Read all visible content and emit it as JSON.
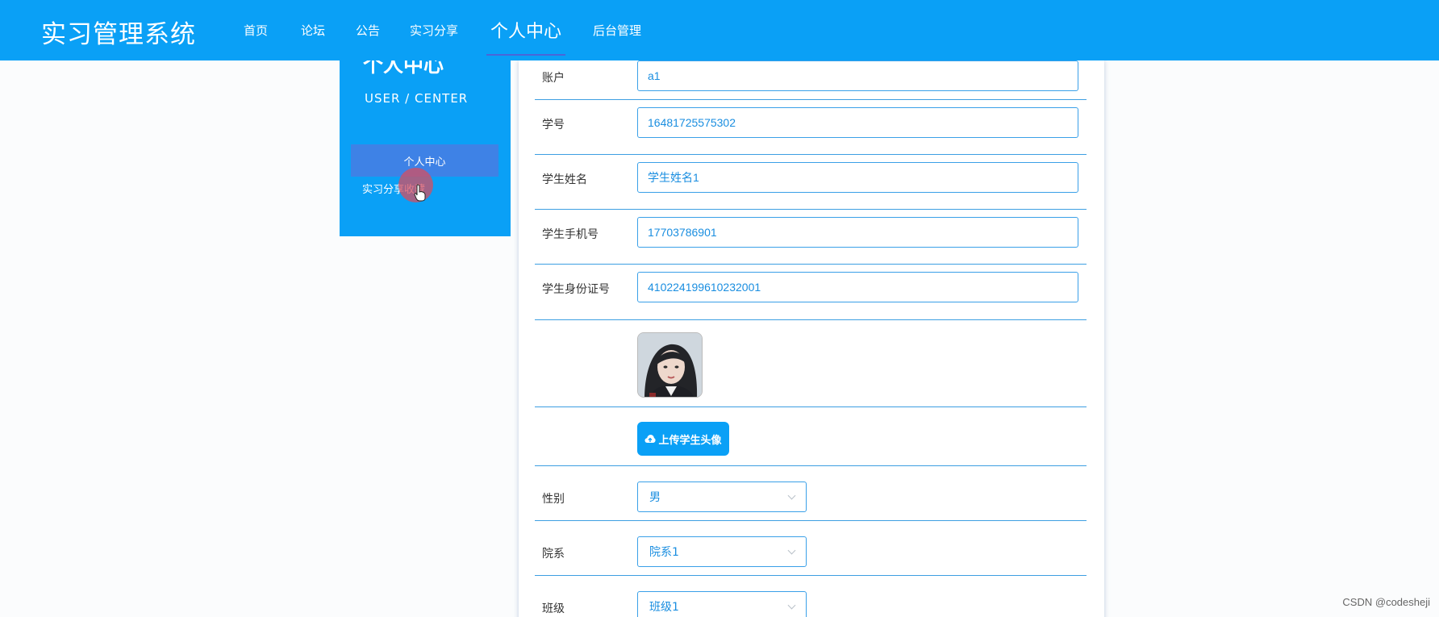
{
  "header": {
    "app_title": "实习管理系统",
    "nav": [
      "首页",
      "论坛",
      "公告",
      "实习分享",
      "个人中心",
      "后台管理"
    ],
    "active_nav": "个人中心"
  },
  "sidebar": {
    "title": "个人中心",
    "subtitle": "USER / CENTER",
    "items": [
      {
        "label": "个人中心",
        "active": true
      },
      {
        "label": "实习分享收藏",
        "active": false
      }
    ]
  },
  "form": {
    "account": {
      "label": "账户",
      "value": "a1"
    },
    "student_no": {
      "label": "学号",
      "value": "16481725575302"
    },
    "student_name": {
      "label": "学生姓名",
      "value": "学生姓名1"
    },
    "phone": {
      "label": "学生手机号",
      "value": "17703786901"
    },
    "id_card": {
      "label": "学生身份证号",
      "value": "410224199610232001"
    },
    "upload_avatar_label": "上传学生头像",
    "gender": {
      "label": "性别",
      "value": "男"
    },
    "department": {
      "label": "院系",
      "value": "院系1"
    },
    "class": {
      "label": "班级",
      "value": "班级1"
    }
  },
  "watermark": "CSDN @codesheji",
  "colors": {
    "primary": "#0aa0f6",
    "active_sidebar": "#3e82e6",
    "field_border": "#3aa0e8",
    "field_text": "#1a8ee0"
  },
  "icons": {
    "upload": "cloud-upload-icon",
    "cursor": "hand-pointer-icon",
    "select_arrow": "chevron-down-icon"
  }
}
